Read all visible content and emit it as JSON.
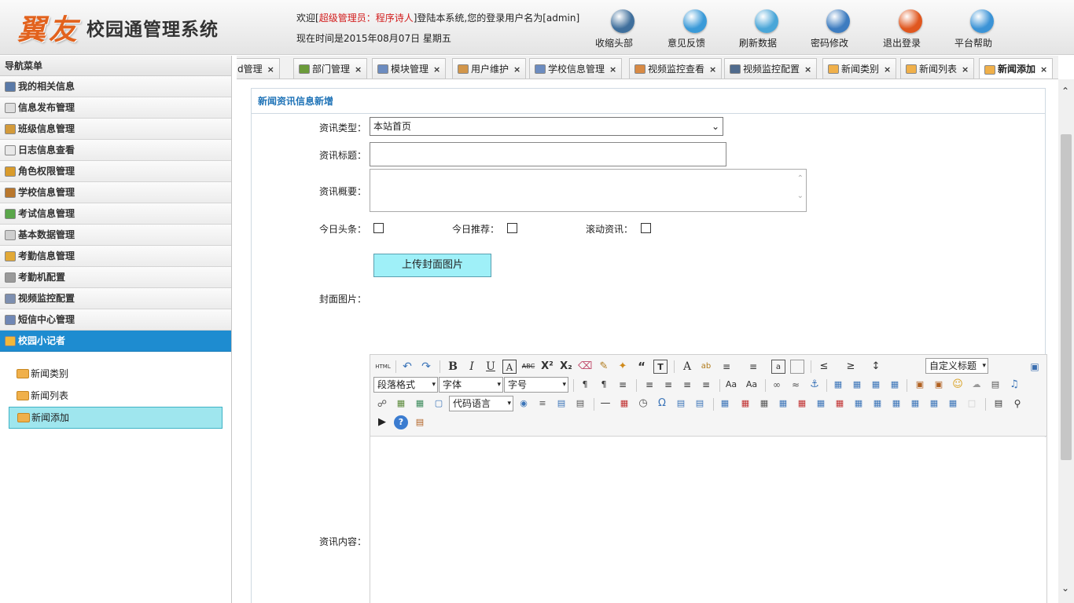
{
  "header": {
    "brand": "翼友",
    "title": "校园通管理系统",
    "welcome_prefix": "欢迎[",
    "welcome_role": "超级管理员：程序诗人",
    "welcome_suffix": "]登陆本系统,您的登录用户名为[admin]",
    "datetime": "现在时间是2015年08月07日 星期五",
    "buttons": [
      {
        "label": "收缩头部",
        "icon": "collapse-up-icon",
        "color": "#3f6f9c"
      },
      {
        "label": "意见反馈",
        "icon": "speech-bubble-icon",
        "color": "#3a9ad8"
      },
      {
        "label": "刷新数据",
        "icon": "refresh-icon",
        "color": "#4aa6d8"
      },
      {
        "label": "密码修改",
        "icon": "move-arrows-icon",
        "color": "#3d7cc0"
      },
      {
        "label": "退出登录",
        "icon": "power-icon",
        "color": "#e0571f"
      },
      {
        "label": "平台帮助",
        "icon": "help-icon",
        "color": "#3b93d6"
      }
    ]
  },
  "nav": {
    "title": "导航菜单",
    "items": [
      {
        "label": "我的相关信息",
        "icon": "user-icon",
        "color": "#5a7aa8"
      },
      {
        "label": "信息发布管理",
        "icon": "documents-icon",
        "color": "#dedede"
      },
      {
        "label": "班级信息管理",
        "icon": "house-icon",
        "color": "#d39a3a"
      },
      {
        "label": "日志信息查看",
        "icon": "log-icon",
        "color": "#e8e8e8"
      },
      {
        "label": "角色权限管理",
        "icon": "role-icon",
        "color": "#d99b2b"
      },
      {
        "label": "学校信息管理",
        "icon": "books-icon",
        "color": "#b9772c"
      },
      {
        "label": "考试信息管理",
        "icon": "exam-icon",
        "color": "#5aa64a"
      },
      {
        "label": "基本数据管理",
        "icon": "database-icon",
        "color": "#cfcfcf"
      },
      {
        "label": "考勤信息管理",
        "icon": "lock-icon",
        "color": "#e2a937"
      },
      {
        "label": "考勤机配置",
        "icon": "device-icon",
        "color": "#9a9a9a"
      },
      {
        "label": "视频监控配置",
        "icon": "eye-icon",
        "color": "#7d8fb0"
      },
      {
        "label": "短信中心管理",
        "icon": "mail-icon",
        "color": "#6f87b5"
      },
      {
        "label": "校园小记者",
        "icon": "medal-icon",
        "color": "#f2b73a"
      }
    ],
    "sub_items": [
      {
        "label": "新闻类别"
      },
      {
        "label": "新闻列表"
      },
      {
        "label": "新闻添加"
      }
    ]
  },
  "tabs": [
    {
      "label": "d管理",
      "color": "#ffffff"
    },
    {
      "label": "部门管理",
      "color": "#6b9b3a"
    },
    {
      "label": "模块管理",
      "color": "#6c8cc0"
    },
    {
      "label": "用户维护",
      "color": "#d2964a"
    },
    {
      "label": "学校信息管理",
      "color": "#6c8cc0"
    },
    {
      "label": "视频监控查看",
      "color": "#d88a44"
    },
    {
      "label": "视频监控配置",
      "color": "#506b8d"
    },
    {
      "label": "新闻类别",
      "color": "#f0b04a"
    },
    {
      "label": "新闻列表",
      "color": "#f0b04a"
    },
    {
      "label": "新闻添加",
      "color": "#f0b04a"
    }
  ],
  "form": {
    "panel_title": "新闻资讯信息新增",
    "type_label": "资讯类型：",
    "type_value": "本站首页",
    "title_label": "资讯标题：",
    "summary_label": "资讯概要：",
    "headline_label": "今日头条：",
    "recommend_label": "今日推荐：",
    "scroll_label": "滚动资讯：",
    "upload_label": "上传封面图片",
    "cover_label": "封面图片：",
    "content_label": "资讯内容："
  },
  "editor": {
    "paragraph_label": "段落格式",
    "font_label": "字体",
    "size_label": "字号",
    "code_label": "代码语言",
    "custom_title_label": "自定义标题"
  }
}
